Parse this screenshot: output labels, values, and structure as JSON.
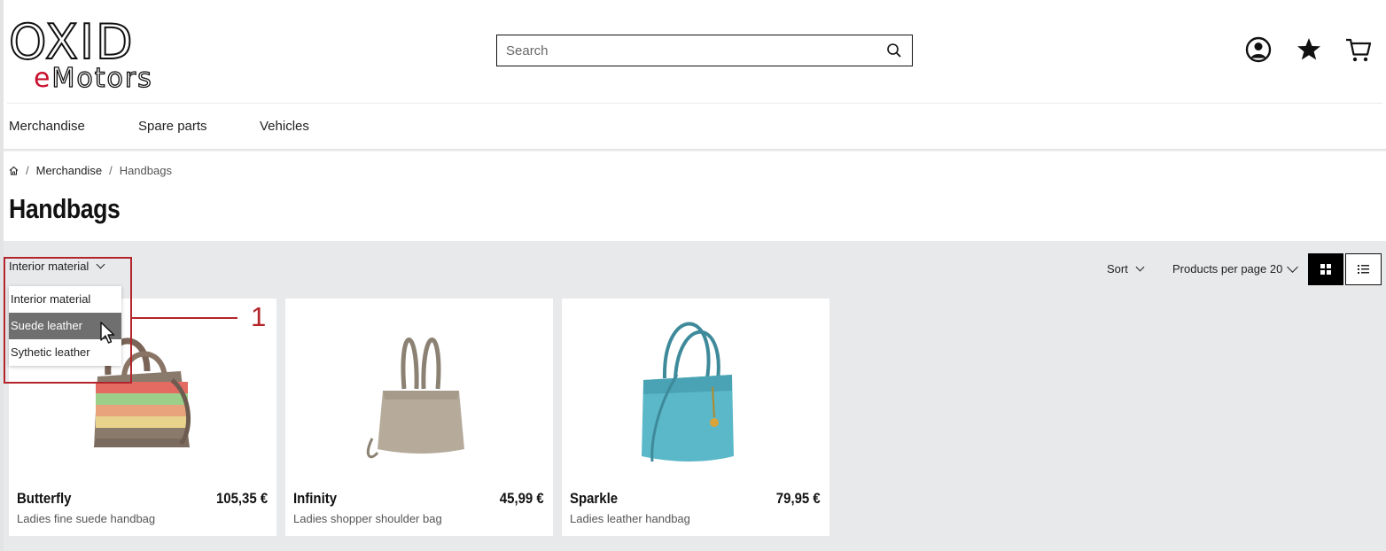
{
  "header": {
    "logo_top": "OXID",
    "logo_bottom_first": "e",
    "logo_bottom_rest": "Motors",
    "logo_accent_color": "#c8102e",
    "search_placeholder": "Search",
    "icons": [
      "search-icon",
      "account-icon",
      "wishlist-star-icon",
      "cart-icon"
    ]
  },
  "nav": {
    "items": [
      "Merchandise",
      "Spare parts",
      "Vehicles"
    ]
  },
  "breadcrumb": {
    "items": [
      "Merchandise",
      "Handbags"
    ]
  },
  "page": {
    "title": "Handbags"
  },
  "toolbar": {
    "filter_label": "Interior material",
    "sort_label": "Sort",
    "per_page_label": "Products per page 20"
  },
  "dropdown": {
    "options": [
      "Interior material",
      "Suede leather",
      "Sythetic leather"
    ],
    "highlighted": "Suede leather"
  },
  "products": [
    {
      "name": "Butterfly",
      "price": "105,35 €",
      "desc": "Ladies fine suede handbag",
      "color": "striped"
    },
    {
      "name": "Infinity",
      "price": "45,99 €",
      "desc": "Ladies shopper shoulder bag",
      "color": "#b6ab9b"
    },
    {
      "name": "Sparkle",
      "price": "79,95 €",
      "desc": "Ladies leather handbag",
      "color": "#5bb8c8"
    }
  ],
  "annotation": {
    "number": "1",
    "color": "#b3242b"
  }
}
